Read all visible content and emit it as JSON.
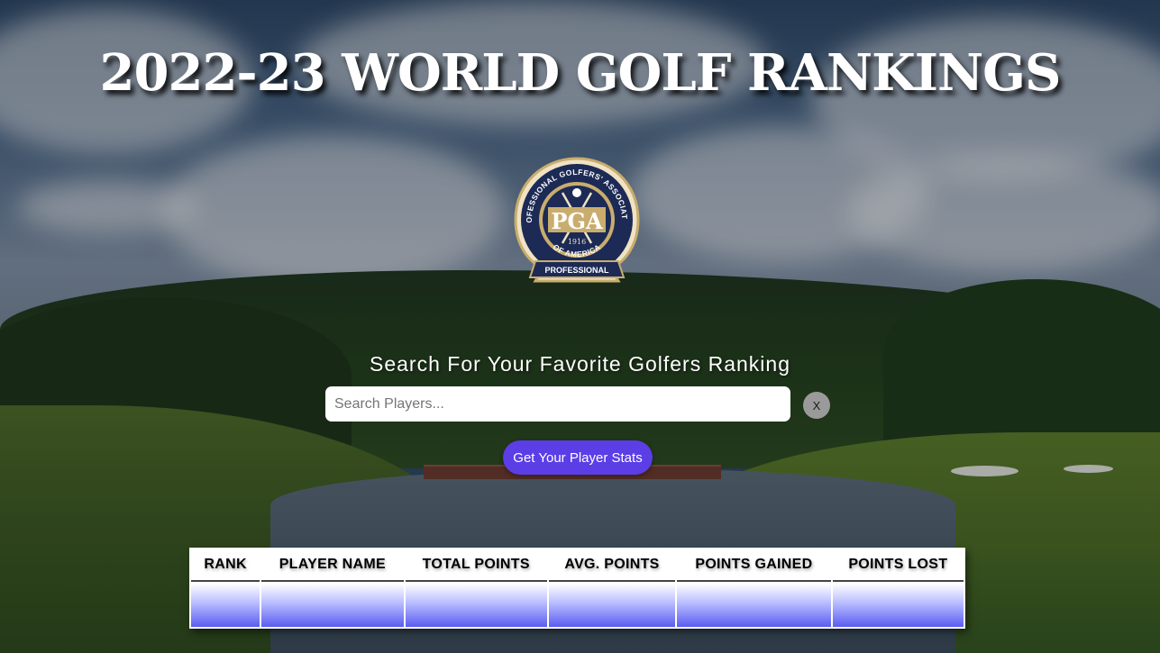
{
  "page": {
    "title": "2022-23 WORLD GOLF RANKINGS"
  },
  "logo": {
    "icon": "pga-logo",
    "ring_top_text": "PROFESSIONAL GOLFERS' ASSOCIATION",
    "ring_bottom_text": "OF AMERICA",
    "center_text": "PGA",
    "year": "1916",
    "banner_text": "PROFESSIONAL",
    "colors": {
      "navy": "#1c2a55",
      "gold": "#c9ad6e",
      "cream": "#efe3c4"
    }
  },
  "search": {
    "heading": "Search For Your Favorite Golfers Ranking",
    "input_value": "",
    "placeholder": "Search Players...",
    "clear_label": "X",
    "submit_label": "Get Your Player Stats"
  },
  "table": {
    "columns": [
      "RANK",
      "PLAYER NAME",
      "TOTAL POINTS",
      "AVG. POINTS",
      "POINTS GAINED",
      "POINTS LOST"
    ],
    "rows": [
      [
        "",
        "",
        "",
        "",
        "",
        ""
      ]
    ]
  },
  "colors": {
    "button_accent": "#5b3ee6",
    "row_gradient_bottom": "#5a5cf0"
  }
}
